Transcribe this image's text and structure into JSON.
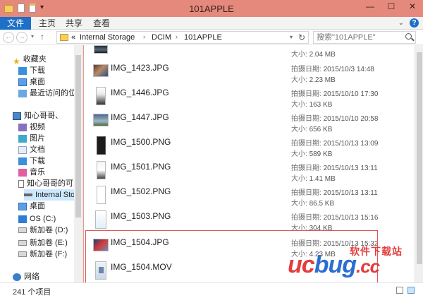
{
  "window": {
    "title": "101APPLE",
    "minimize": "—",
    "maximize": "☐",
    "close": "✕"
  },
  "ribbon": {
    "tabs": [
      "文件",
      "主页",
      "共享",
      "查看"
    ],
    "expand": "⌄",
    "help": "?"
  },
  "nav": {
    "back": "←",
    "forward": "→",
    "up": "↑",
    "dropdown": "▾",
    "crumb_prefix": "«",
    "crumbs": [
      "Internal Storage",
      "DCIM",
      "101APPLE"
    ],
    "crumb_sep": "›",
    "refresh": "↻",
    "search_placeholder": "搜索\"101APPLE\""
  },
  "sidebar": {
    "items": [
      {
        "label": "收藏夹"
      },
      {
        "label": "下载"
      },
      {
        "label": "桌面"
      },
      {
        "label": "最近访问的位置"
      },
      {
        "label": "知心哥哥、"
      },
      {
        "label": "视频"
      },
      {
        "label": "图片"
      },
      {
        "label": "文档"
      },
      {
        "label": "下载"
      },
      {
        "label": "音乐"
      },
      {
        "label": "知心哥哥的可爱小"
      },
      {
        "label": "Internal Storage"
      },
      {
        "label": "桌面"
      },
      {
        "label": "OS (C:)"
      },
      {
        "label": "新加卷 (D:)"
      },
      {
        "label": "新加卷 (E:)"
      },
      {
        "label": "新加卷 (F:)"
      },
      {
        "label": "网络"
      }
    ]
  },
  "files": {
    "date_label": "拍摄日期:",
    "size_label": "大小:",
    "partial_size": "2.04 MB",
    "rows": [
      {
        "name": "IMG_1423.JPG",
        "date": "2015/10/3 14:48",
        "size": "2.23 MB"
      },
      {
        "name": "IMG_1446.JPG",
        "date": "2015/10/10 17:30",
        "size": "163 KB"
      },
      {
        "name": "IMG_1447.JPG",
        "date": "2015/10/10 20:58",
        "size": "656 KB"
      },
      {
        "name": "IMG_1500.PNG",
        "date": "2015/10/13 13:09",
        "size": "589 KB"
      },
      {
        "name": "IMG_1501.PNG",
        "date": "2015/10/13 13:11",
        "size": "1.41 MB"
      },
      {
        "name": "IMG_1502.PNG",
        "date": "2015/10/13 13:11",
        "size": "86.5 KB"
      },
      {
        "name": "IMG_1503.PNG",
        "date": "2015/10/13 15:16",
        "size": "304 KB"
      },
      {
        "name": "IMG_1504.JPG",
        "date": "2015/10/13 15:32",
        "size": "4.23 MB"
      },
      {
        "name": "IMG_1504.MOV",
        "date": "",
        "size": ""
      }
    ]
  },
  "status": {
    "count": "241 个项目"
  },
  "watermark": {
    "cn": "软件下载站",
    "logo_uc": "uc",
    "logo_bug": "bug",
    "logo_cc": ".cc"
  },
  "colors": {
    "titlebar": "#e5897c",
    "file_tab": "#1d6fc7",
    "highlight_border": "#e05656",
    "watermark_red": "#e33d3d",
    "watermark_blue": "#2b6ed1"
  }
}
